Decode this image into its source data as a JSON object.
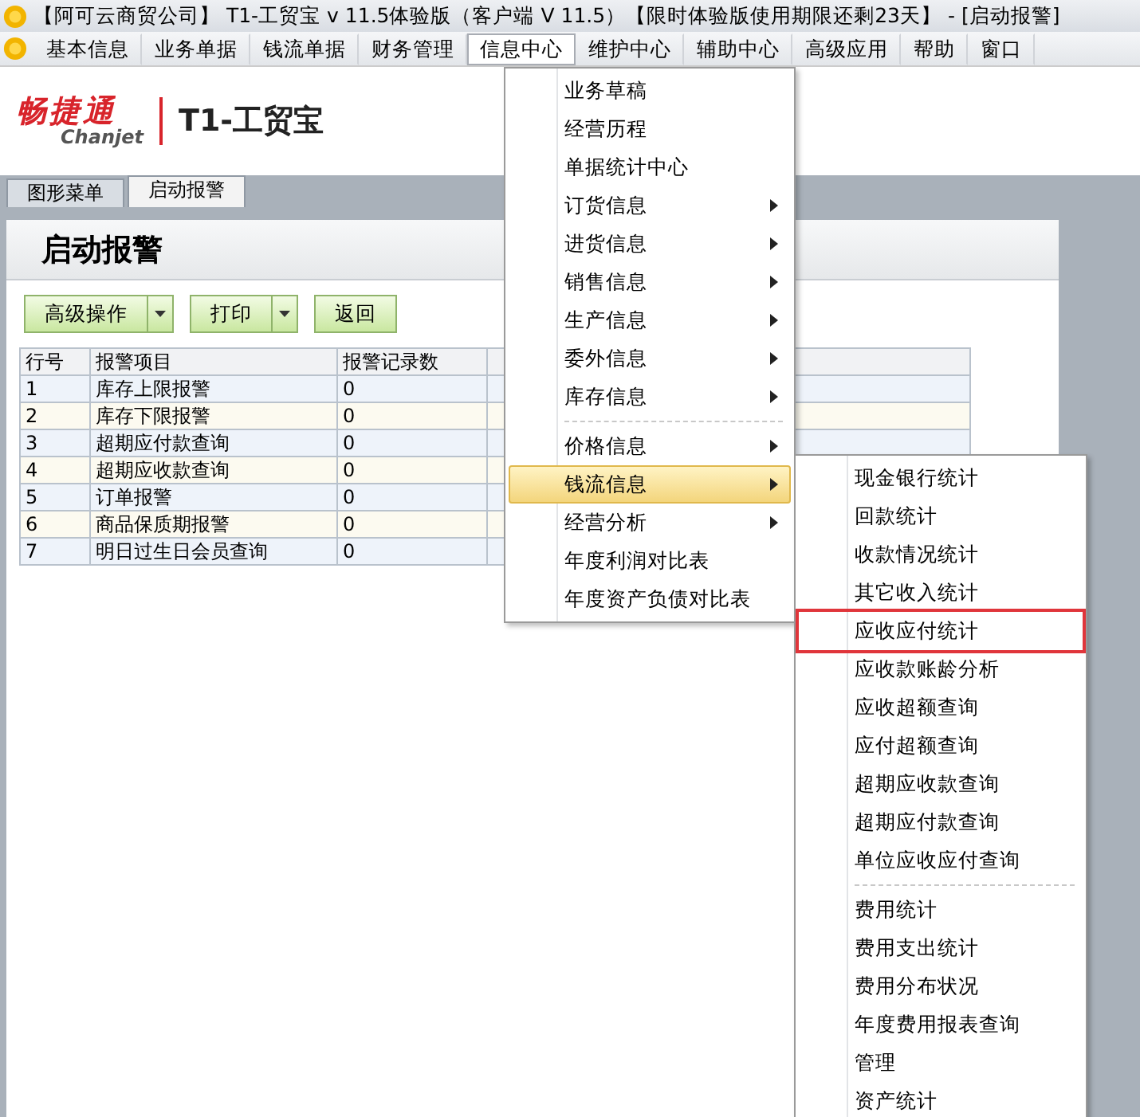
{
  "window": {
    "title": "【阿可云商贸公司】 T1-工贸宝 v 11.5体验版（客户端 V 11.5）【限时体验版使用期限还剩23天】 - [启动报警]"
  },
  "menu_bar": [
    {
      "label": "基本信息",
      "selected": false
    },
    {
      "label": "业务单据",
      "selected": false
    },
    {
      "label": "钱流单据",
      "selected": false
    },
    {
      "label": "财务管理",
      "selected": false
    },
    {
      "label": "信息中心",
      "selected": true
    },
    {
      "label": "维护中心",
      "selected": false
    },
    {
      "label": "辅助中心",
      "selected": false
    },
    {
      "label": "高级应用",
      "selected": false
    },
    {
      "label": "帮助",
      "selected": false
    },
    {
      "label": "窗口",
      "selected": false
    }
  ],
  "logo": {
    "brand": "畅捷通",
    "brand_en": "Chanjet",
    "product": "T1-工贸宝"
  },
  "tabs": [
    {
      "label": "图形菜单",
      "selected": false
    },
    {
      "label": "启动报警",
      "selected": true
    }
  ],
  "page_title": "启动报警",
  "toolbar": [
    {
      "label": "高级操作",
      "dropdown": true
    },
    {
      "label": "打印",
      "dropdown": true
    },
    {
      "label": "返回",
      "dropdown": false
    }
  ],
  "table": {
    "columns": [
      "行号",
      "报警项目",
      "报警记录数"
    ],
    "rows": [
      [
        "1",
        "库存上限报警",
        "0"
      ],
      [
        "2",
        "库存下限报警",
        "0"
      ],
      [
        "3",
        "超期应付款查询",
        "0"
      ],
      [
        "4",
        "超期应收款查询",
        "0"
      ],
      [
        "5",
        "订单报警",
        "0"
      ],
      [
        "6",
        "商品保质期报警",
        "0"
      ],
      [
        "7",
        "明日过生日会员查询",
        "0"
      ]
    ]
  },
  "menu": [
    {
      "label": "业务草稿",
      "submenu": false,
      "selected": false,
      "separator_before": false
    },
    {
      "label": "经营历程",
      "submenu": false,
      "selected": false,
      "separator_before": false
    },
    {
      "label": "单据统计中心",
      "submenu": false,
      "selected": false,
      "separator_before": false
    },
    {
      "label": "订货信息",
      "submenu": true,
      "selected": false,
      "separator_before": false
    },
    {
      "label": "进货信息",
      "submenu": true,
      "selected": false,
      "separator_before": false
    },
    {
      "label": "销售信息",
      "submenu": true,
      "selected": false,
      "separator_before": false
    },
    {
      "label": "生产信息",
      "submenu": true,
      "selected": false,
      "separator_before": false
    },
    {
      "label": "委外信息",
      "submenu": true,
      "selected": false,
      "separator_before": false
    },
    {
      "label": "库存信息",
      "submenu": true,
      "selected": false,
      "separator_before": false
    },
    {
      "label": "价格信息",
      "submenu": true,
      "selected": false,
      "separator_before": true
    },
    {
      "label": "钱流信息",
      "submenu": true,
      "selected": true,
      "separator_before": false
    },
    {
      "label": "经营分析",
      "submenu": true,
      "selected": false,
      "separator_before": false
    },
    {
      "label": "年度利润对比表",
      "submenu": false,
      "selected": false,
      "separator_before": false
    },
    {
      "label": "年度资产负债对比表",
      "submenu": false,
      "selected": false,
      "separator_before": false
    }
  ],
  "submenu": [
    {
      "label": "现金银行统计",
      "highlighted": false,
      "separator_before": false
    },
    {
      "label": "回款统计",
      "highlighted": false,
      "separator_before": false
    },
    {
      "label": "收款情况统计",
      "highlighted": false,
      "separator_before": false
    },
    {
      "label": "其它收入统计",
      "highlighted": false,
      "separator_before": false
    },
    {
      "label": "应收应付统计",
      "highlighted": true,
      "separator_before": false
    },
    {
      "label": "应收款账龄分析",
      "highlighted": false,
      "separator_before": false
    },
    {
      "label": "应收超额查询",
      "highlighted": false,
      "separator_before": false
    },
    {
      "label": "应付超额查询",
      "highlighted": false,
      "separator_before": false
    },
    {
      "label": "超期应收款查询",
      "highlighted": false,
      "separator_before": false
    },
    {
      "label": "超期应付款查询",
      "highlighted": false,
      "separator_before": false
    },
    {
      "label": "单位应收应付查询",
      "highlighted": false,
      "separator_before": false
    },
    {
      "label": "费用统计",
      "highlighted": false,
      "separator_before": true
    },
    {
      "label": "费用支出统计",
      "highlighted": false,
      "separator_before": false
    },
    {
      "label": "费用分布状况",
      "highlighted": false,
      "separator_before": false
    },
    {
      "label": "年度费用报表查询",
      "highlighted": false,
      "separator_before": false
    },
    {
      "label": "管理",
      "highlighted": false,
      "separator_before": false
    },
    {
      "label": "资产统计",
      "highlighted": false,
      "separator_before": false
    }
  ]
}
